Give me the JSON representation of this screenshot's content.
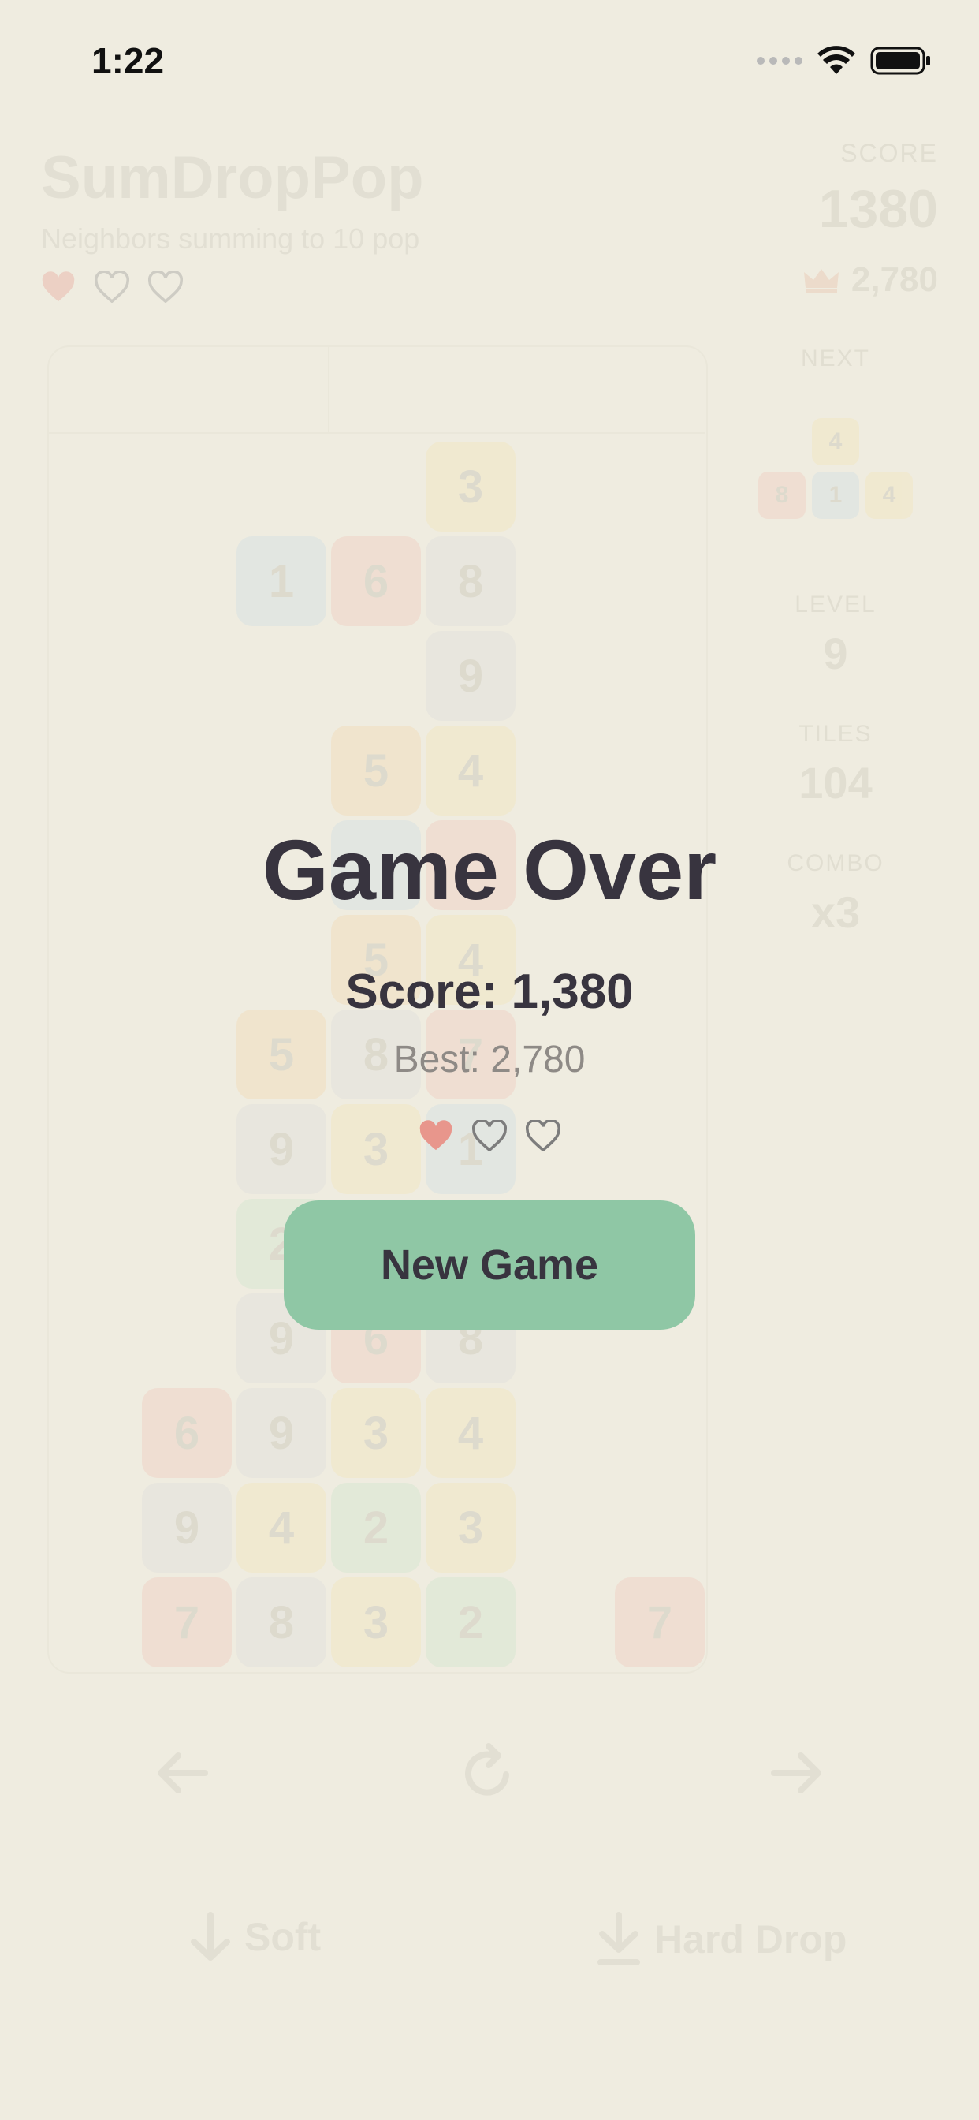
{
  "status_bar": {
    "time": "1:22"
  },
  "app": {
    "title": "SumDropPop",
    "subtitle": "Neighbors summing to 10 pop"
  },
  "score_panel": {
    "score_label": "SCORE",
    "score": "1380",
    "best": "2,780"
  },
  "next": {
    "label": "NEXT",
    "piece": [
      "4",
      "8",
      "1",
      "4"
    ]
  },
  "stats": {
    "level_label": "LEVEL",
    "level": "9",
    "tiles_label": "TILES",
    "tiles": "104",
    "combo_label": "COMBO",
    "combo": "x3"
  },
  "lives": {
    "total": 3,
    "filled": 1
  },
  "board": {
    "tiles": [
      {
        "col": 4,
        "row": 0,
        "value": "3",
        "color": "yellow"
      },
      {
        "col": 2,
        "row": 1,
        "value": "1",
        "color": "blue"
      },
      {
        "col": 3,
        "row": 1,
        "value": "6",
        "color": "red"
      },
      {
        "col": 4,
        "row": 1,
        "value": "8",
        "color": "gray"
      },
      {
        "col": 4,
        "row": 2,
        "value": "9",
        "color": "gray"
      },
      {
        "col": 3,
        "row": 3,
        "value": "5",
        "color": "orange"
      },
      {
        "col": 4,
        "row": 3,
        "value": "4",
        "color": "yellow"
      },
      {
        "col": 3,
        "row": 4,
        "value": "",
        "color": "blue"
      },
      {
        "col": 4,
        "row": 4,
        "value": "",
        "color": "red"
      },
      {
        "col": 3,
        "row": 5,
        "value": "5",
        "color": "orange"
      },
      {
        "col": 4,
        "row": 5,
        "value": "4",
        "color": "yellow"
      },
      {
        "col": 2,
        "row": 6,
        "value": "5",
        "color": "orange"
      },
      {
        "col": 3,
        "row": 6,
        "value": "8",
        "color": "gray"
      },
      {
        "col": 4,
        "row": 6,
        "value": "7",
        "color": "red"
      },
      {
        "col": 2,
        "row": 7,
        "value": "9",
        "color": "gray"
      },
      {
        "col": 3,
        "row": 7,
        "value": "3",
        "color": "yellow"
      },
      {
        "col": 4,
        "row": 7,
        "value": "1",
        "color": "blue"
      },
      {
        "col": 2,
        "row": 8,
        "value": "2",
        "color": "green"
      },
      {
        "col": 2,
        "row": 9,
        "value": "9",
        "color": "gray"
      },
      {
        "col": 3,
        "row": 9,
        "value": "6",
        "color": "red"
      },
      {
        "col": 4,
        "row": 9,
        "value": "8",
        "color": "gray"
      },
      {
        "col": 1,
        "row": 10,
        "value": "6",
        "color": "red"
      },
      {
        "col": 2,
        "row": 10,
        "value": "9",
        "color": "gray"
      },
      {
        "col": 3,
        "row": 10,
        "value": "3",
        "color": "yellow"
      },
      {
        "col": 4,
        "row": 10,
        "value": "4",
        "color": "yellow"
      },
      {
        "col": 1,
        "row": 11,
        "value": "9",
        "color": "gray"
      },
      {
        "col": 2,
        "row": 11,
        "value": "4",
        "color": "yellow"
      },
      {
        "col": 3,
        "row": 11,
        "value": "2",
        "color": "green"
      },
      {
        "col": 4,
        "row": 11,
        "value": "3",
        "color": "yellow"
      },
      {
        "col": 1,
        "row": 12,
        "value": "7",
        "color": "red"
      },
      {
        "col": 2,
        "row": 12,
        "value": "8",
        "color": "gray"
      },
      {
        "col": 3,
        "row": 12,
        "value": "3",
        "color": "yellow"
      },
      {
        "col": 4,
        "row": 12,
        "value": "2",
        "color": "green"
      },
      {
        "col": 6,
        "row": 12,
        "value": "7",
        "color": "red"
      }
    ]
  },
  "controls": {
    "soft_label": "Soft",
    "hard_label": "Hard Drop"
  },
  "game_over": {
    "title": "Game Over",
    "score_text": "Score: 1,380",
    "best_text": "Best: 2,780",
    "button_label": "New Game"
  },
  "colors": {
    "background": "#EFECE0",
    "button": "#8FC7A5",
    "heart_filled": "#E8968C",
    "heart_outline": "#8b8b8b",
    "text_dark": "#38343F",
    "tile_yellow": "#F3E3B0",
    "tile_blue": "#C9DCE6",
    "tile_red": "#F1C3B5",
    "tile_gray": "#DCDCDC",
    "tile_orange": "#F3D6A7",
    "tile_green": "#C9E4C8"
  }
}
